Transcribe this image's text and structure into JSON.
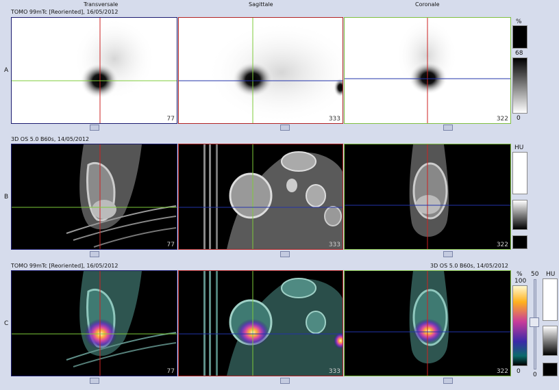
{
  "colors": {
    "background": "#d6dcec",
    "transversal_border": "#1a1a6e",
    "sagittal_border": "#b22222",
    "coronal_border": "#7fbf3f",
    "crosshair_red": "#cc2222",
    "crosshair_green": "#7ecb3a",
    "crosshair_blue": "#2233aa"
  },
  "views": {
    "transversale": "Transversale",
    "sagittale": "Sagittale",
    "coronale": "Coronale"
  },
  "row_a": {
    "label": "A",
    "header": "TOMO 99mTc [Reoriented], 16/05/2012",
    "slices": [
      "77",
      "333",
      "322"
    ],
    "scale": {
      "unit": "%",
      "max": "68",
      "min": "0"
    }
  },
  "row_b": {
    "label": "B",
    "header": "3D OS 5.0 B60s, 14/05/2012",
    "slices": [
      "77",
      "333",
      "322"
    ],
    "scale": {
      "unit": "HU"
    }
  },
  "row_c": {
    "label": "C",
    "header_left": "TOMO 99mTc [Reoriented], 16/05/2012",
    "header_right": "3D OS 5.0 B60s, 14/05/2012",
    "slices": [
      "77",
      "333",
      "322"
    ],
    "scale_spect": {
      "unit": "%",
      "max": "100",
      "min": "0"
    },
    "blend": {
      "value": "50",
      "min": "0"
    },
    "scale_ct": {
      "unit": "HU"
    }
  }
}
